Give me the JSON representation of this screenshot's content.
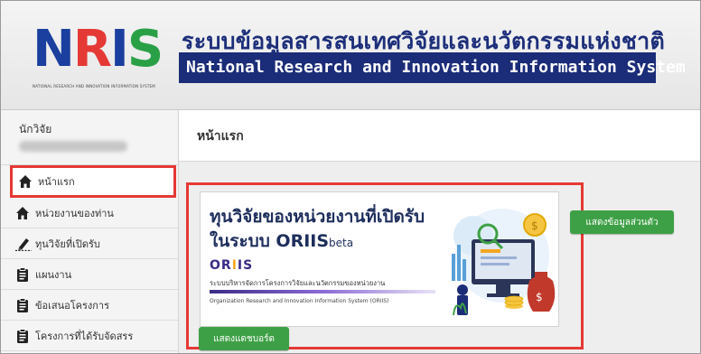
{
  "header": {
    "logo": {
      "letters": [
        "N",
        "R",
        "I",
        "S"
      ],
      "colors": [
        "#1a3f9e",
        "#e53935",
        "#1a3f9e",
        "#2aa046"
      ],
      "tagline": "NATIONAL RESEARCH AND INNOVATION INFORMATION SYSTEM"
    },
    "title_th": "ระบบข้อมูลสารสนเทศวิจัยและนวัตกรรมแห่งชาติ",
    "title_en": "National Research and Innovation Information System"
  },
  "sidebar": {
    "user_role": "นักวิจัย",
    "items": [
      {
        "label": "หน้าแรก",
        "icon": "home-icon",
        "active": true
      },
      {
        "label": "หน่วยงานของท่าน",
        "icon": "home-icon"
      },
      {
        "label": "ทุนวิจัยที่เปิดรับ",
        "icon": "pen-icon"
      },
      {
        "label": "แผนงาน",
        "icon": "clipboard-icon"
      },
      {
        "label": "ข้อเสนอโครงการ",
        "icon": "clipboard-icon"
      },
      {
        "label": "โครงการที่ได้รับจัดสรร",
        "icon": "clipboard-icon"
      }
    ]
  },
  "main": {
    "page_title": "หน้าแรก",
    "banner": {
      "title_line1": "ทุนวิจัยของหน่วยงานที่เปิดรับ",
      "title_line2": "ในระบบ ORIIS",
      "beta": "beta",
      "oriis_logo": "ORIIS",
      "subtitle_th": "ระบบบริหารจัดการโครงการวิจัยและนวัตกรรมของหน่วยงาน",
      "subtitle_en": "Organization Research and Innovation Information System (ORIIS)"
    },
    "profile_button": "แสดงข้อมูลส่วนตัว",
    "bottom_button": "แสดงแดชบอร์ด"
  },
  "colors": {
    "accent_red": "#e53935",
    "navy": "#1b2c78",
    "green": "#3ea046"
  }
}
